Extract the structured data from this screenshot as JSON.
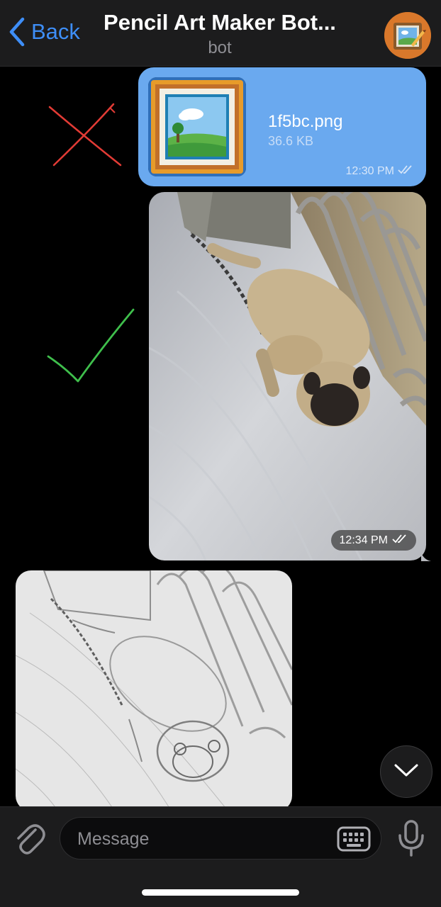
{
  "header": {
    "back_label": "Back",
    "title": "Pencil Art Maker Bot...",
    "subtitle": "bot",
    "accent": "#3e8ef7"
  },
  "messages": {
    "file": {
      "name": "1f5bc.png",
      "size": "36.6 KB",
      "time": "12:30 PM",
      "bubble_color": "#6aa9ef"
    },
    "photo": {
      "time": "12:34 PM"
    }
  },
  "annotations": {
    "cross_color": "#e23b35",
    "check_color": "#3fbf4c"
  },
  "input": {
    "placeholder": "Message"
  }
}
